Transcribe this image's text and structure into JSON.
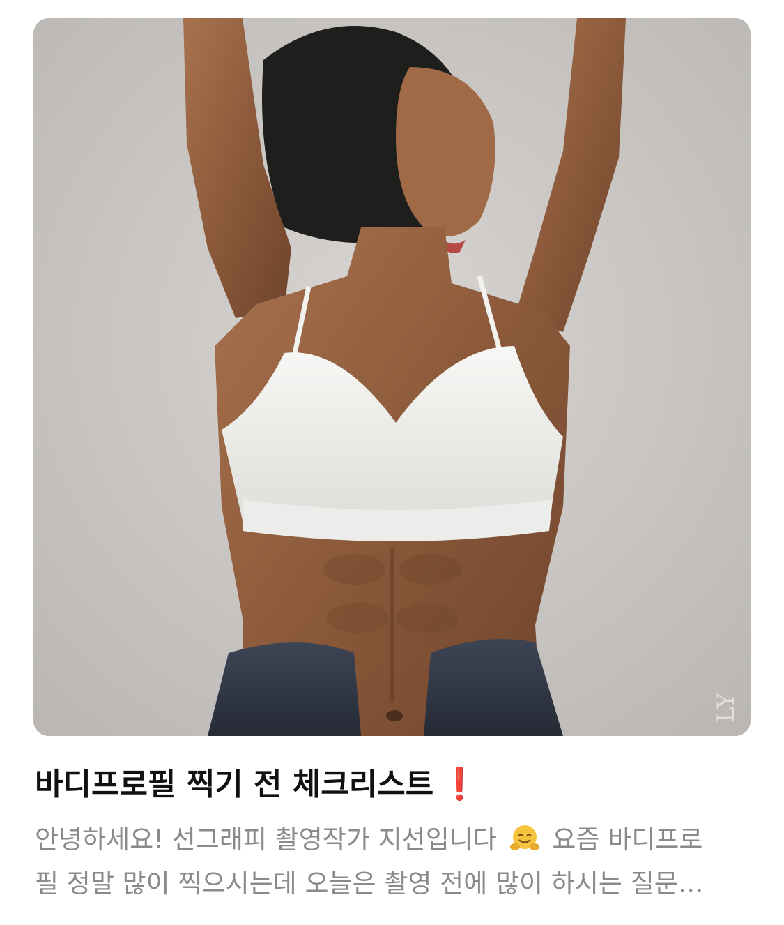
{
  "post": {
    "title": "바디프로필 찍기 전 체크리스트",
    "title_mark": "❗",
    "snippet_line1_before_emoji": "안녕하세요! 선그래피 촬영작가 지선입니다",
    "snippet_emoji": "hugging-face-icon",
    "snippet_line1_after_emoji": "요즘 바디프로",
    "snippet_line2": "필 정말 많이 찍으시는데 오늘은 촬영 전에 많이 하시는 질문…",
    "image_watermark": "LY"
  },
  "colors": {
    "title": "#111111",
    "snippet": "#8a8a8a",
    "exclamation": "#d9262c",
    "background": "#ffffff"
  }
}
